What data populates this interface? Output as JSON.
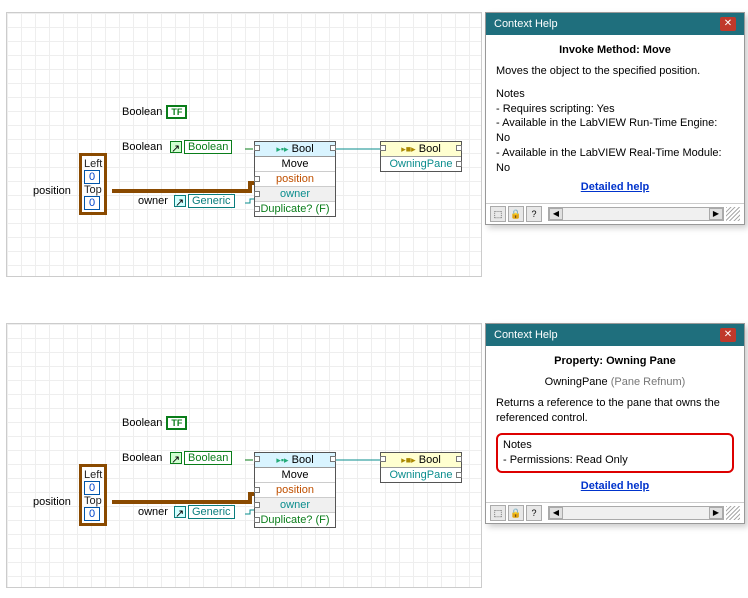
{
  "help1": {
    "title": "Context Help",
    "heading": "Invoke Method:  Move",
    "desc": "Moves the object to the specified position.",
    "notes_label": "Notes",
    "notes": [
      " - Requires scripting: Yes",
      " - Available in the LabVIEW Run-Time Engine: No",
      " - Available in the LabVIEW Real-Time Module: No"
    ],
    "link": "Detailed help"
  },
  "help2": {
    "title": "Context Help",
    "heading": "Property:  Owning Pane",
    "typeline1": "OwningPane",
    "typeline2": "(Pane Refnum)",
    "desc": "Returns a reference to the pane that owns the referenced control.",
    "notes_label": "Notes",
    "notes": [
      " - Permissions: Read Only"
    ],
    "link": "Detailed help"
  },
  "diagram": {
    "boolean_lbl": "Boolean",
    "tf": "TF",
    "boolean2_lbl": "Boolean",
    "boolean_ref": "Boolean",
    "owner_lbl": "owner",
    "generic_ref": "Generic",
    "position_lbl": "position",
    "cluster": {
      "left_lbl": "Left",
      "left_val": "0",
      "top_lbl": "Top",
      "top_val": "0"
    },
    "invoke": {
      "class": "Bool",
      "method": "Move",
      "p1": "position",
      "p2": "owner",
      "dup": "Duplicate? (F)"
    },
    "prop": {
      "class": "Bool",
      "item": "OwningPane"
    }
  },
  "toolbar": {
    "lock": "🔒",
    "pin": "📌",
    "q": "?"
  }
}
